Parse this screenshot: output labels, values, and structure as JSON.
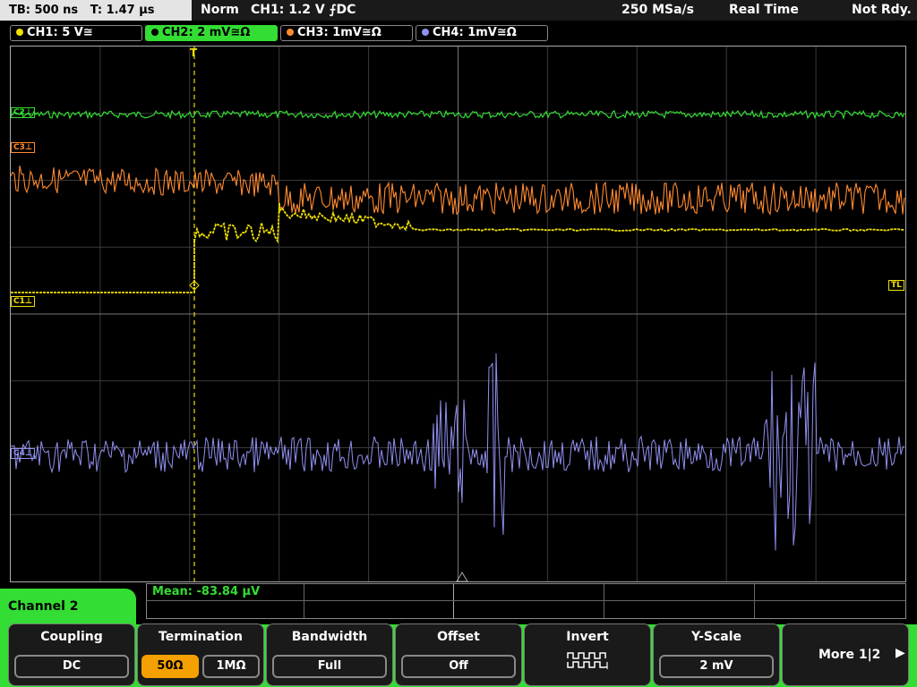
{
  "status": {
    "timebase": "TB: 500 ns",
    "trigger_time": "T: 1.47 µs",
    "trigger_mode": "Norm",
    "trigger_source": "CH1: 1.2 V ⨍DC",
    "sample_rate": "250 MSa/s",
    "acq_mode": "Real Time",
    "ready_state": "Not Rdy."
  },
  "channels": [
    {
      "label": "CH1: 5 V≅",
      "color": "#f0e000"
    },
    {
      "label": "CH2: 2 mV≅Ω",
      "color": "#33dd33"
    },
    {
      "label": "CH3: 1mV≅Ω",
      "color": "#ff8a30"
    },
    {
      "label": "CH4: 1mV≅Ω",
      "color": "#9090f0"
    }
  ],
  "markers": {
    "c1": "C1⊥",
    "c2": "C2⊥",
    "c3": "C3⊥",
    "c4": "C4⊥",
    "tl": "TL",
    "trigger": "T"
  },
  "measurement": {
    "mean": "Mean: -83.84 µV"
  },
  "menu": {
    "title": "Channel 2",
    "coupling": {
      "title": "Coupling",
      "value": "DC"
    },
    "termination": {
      "title": "Termination",
      "opt1": "50Ω",
      "opt2": "1MΩ"
    },
    "bandwidth": {
      "title": "Bandwidth",
      "value": "Full"
    },
    "offset": {
      "title": "Offset",
      "value": "Off"
    },
    "invert": {
      "title": "Invert",
      "icon": "invert-square-wave-icon"
    },
    "yscale": {
      "title": "Y-Scale",
      "value": "2 mV"
    },
    "more": {
      "label": "More 1|2",
      "icon": "play-right-icon"
    }
  }
}
